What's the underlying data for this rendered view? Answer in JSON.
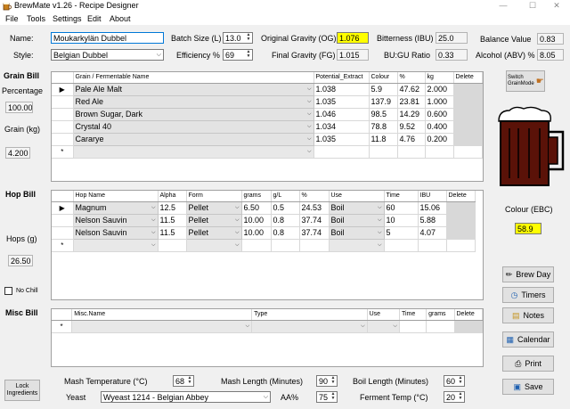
{
  "window": {
    "title": "BrewMate v1.26 - Recipe Designer",
    "min_icon": "minimize-icon",
    "max_icon": "maximize-icon",
    "close_icon": "close-icon"
  },
  "menu": [
    "File",
    "Tools",
    "Settings",
    "Edit",
    "About"
  ],
  "recipe": {
    "name_label": "Name:",
    "name_value": "Moukarkylän Dubbel",
    "style_label": "Style:",
    "style_value": "Belgian Dubbel",
    "batch_label": "Batch Size (L)",
    "batch_value": "13.0",
    "eff_label": "Efficiency %",
    "eff_value": "69",
    "og_label": "Original Gravity (OG)",
    "og_value": "1.076",
    "fg_label": "Final Gravity (FG)",
    "fg_value": "1.015",
    "ibu_label": "Bitterness (IBU)",
    "ibu_value": "25.0",
    "bugu_label": "BU:GU Ratio",
    "bugu_value": "0.33",
    "balance_label": "Balance Value",
    "balance_value": "0.83",
    "abv_label": "Alcohol (ABV) %",
    "abv_value": "8.05"
  },
  "grain": {
    "section_label": "Grain Bill",
    "pct_label": "Percentage",
    "pct_value": "100.00",
    "kg_label": "Grain (kg)",
    "kg_value": "4.200",
    "switch_label": "Switch GrainMode",
    "columns": [
      "Grain / Fermentable Name",
      "Potential_Extract",
      "Colour",
      "%",
      "kg",
      "Delete"
    ],
    "rows": [
      {
        "name": "Pale Ale Malt",
        "extract": "1.038",
        "colour": "5.9",
        "pct": "47.62",
        "kg": "2.000"
      },
      {
        "name": "Red Ale",
        "extract": "1.035",
        "colour": "137.9",
        "pct": "23.81",
        "kg": "1.000"
      },
      {
        "name": "Brown Sugar, Dark",
        "extract": "1.046",
        "colour": "98.5",
        "pct": "14.29",
        "kg": "0.600"
      },
      {
        "name": "Crystal 40",
        "extract": "1.034",
        "colour": "78.8",
        "pct": "9.52",
        "kg": "0.400"
      },
      {
        "name": "Cararye",
        "extract": "1.035",
        "colour": "11.8",
        "pct": "4.76",
        "kg": "0.200"
      }
    ],
    "new_row_marker": "*",
    "current_row_marker": "▶"
  },
  "colour": {
    "label": "Colour (EBC)",
    "value": "58.9",
    "beer_color": "#5a1208"
  },
  "hop": {
    "section_label": "Hop Bill",
    "grams_label": "Hops (g)",
    "grams_value": "26.50",
    "nochill_label": "No Chill",
    "columns": [
      "Hop Name",
      "Alpha",
      "Form",
      "grams",
      "g/L",
      "%",
      "Use",
      "Time",
      "IBU",
      "Delete"
    ],
    "rows": [
      {
        "name": "Magnum",
        "alpha": "12.5",
        "form": "Pellet",
        "grams": "6.50",
        "gl": "0.5",
        "pct": "24.53",
        "use": "Boil",
        "time": "60",
        "ibu": "15.06"
      },
      {
        "name": "Nelson Sauvin",
        "alpha": "11.5",
        "form": "Pellet",
        "grams": "10.00",
        "gl": "0.8",
        "pct": "37.74",
        "use": "Boil",
        "time": "10",
        "ibu": "5.88"
      },
      {
        "name": "Nelson Sauvin",
        "alpha": "11.5",
        "form": "Pellet",
        "grams": "10.00",
        "gl": "0.8",
        "pct": "37.74",
        "use": "Boil",
        "time": "5",
        "ibu": "4.07"
      }
    ]
  },
  "misc": {
    "section_label": "Misc Bill",
    "columns": [
      "Misc.Name",
      "Type",
      "Use",
      "Time",
      "grams",
      "Delete"
    ]
  },
  "buttons": {
    "brew_day": "Brew Day",
    "timers": "Timers",
    "notes": "Notes",
    "calendar": "Calendar",
    "print": "Print",
    "save": "Save",
    "lock": "Lock Ingredients"
  },
  "mash": {
    "temp_label": "Mash Temperature (°C)",
    "temp_value": "68",
    "length_label": "Mash Length (Minutes)",
    "length_value": "90",
    "boil_label": "Boil Length (Minutes)",
    "boil_value": "60",
    "yeast_label": "Yeast",
    "yeast_value": "Wyeast 1214 - Belgian Abbey",
    "aa_label": "AA%",
    "aa_value": "75",
    "ferm_label": "Ferment Temp (°C)",
    "ferm_value": "20"
  }
}
